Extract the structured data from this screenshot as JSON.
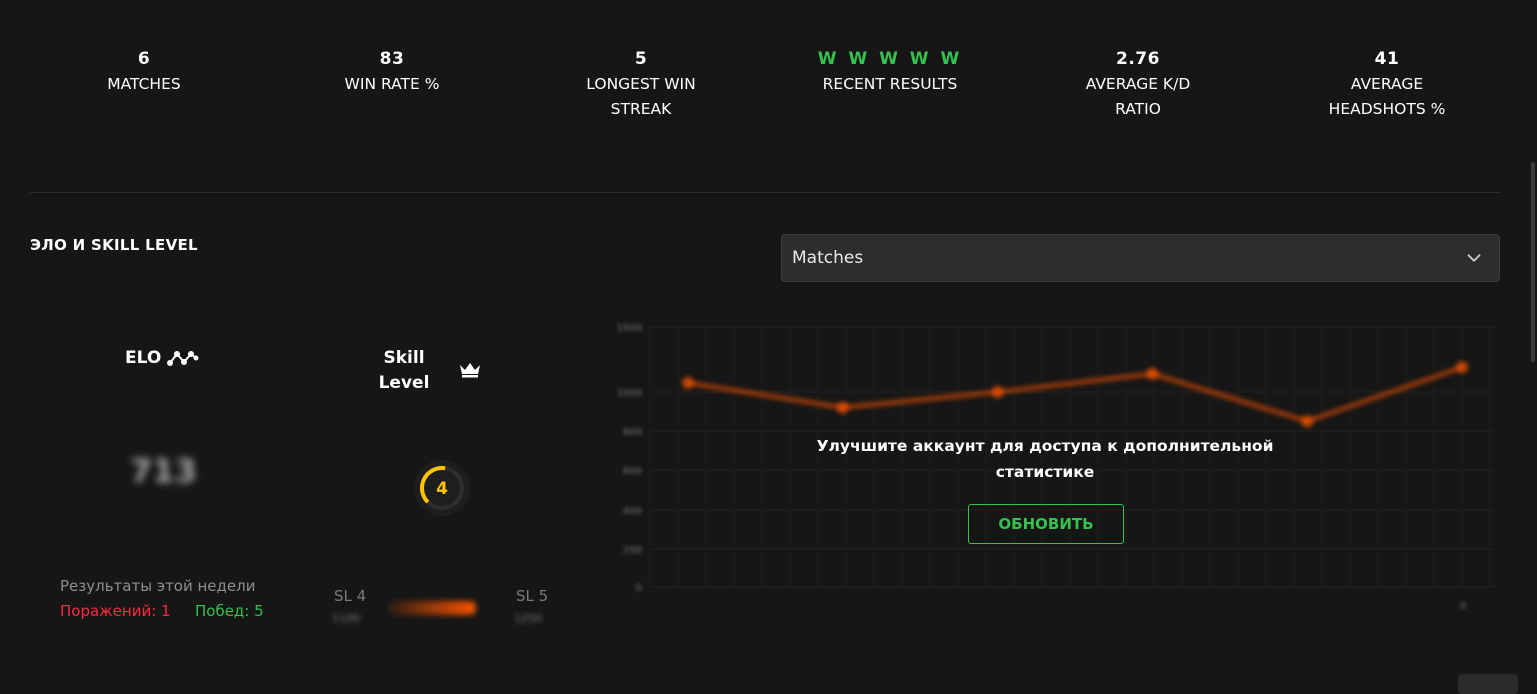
{
  "stats": [
    {
      "value": "6",
      "label": "MATCHES"
    },
    {
      "value": "83",
      "label": "WIN RATE %"
    },
    {
      "value": "5",
      "label": "LONGEST WIN\nSTREAK"
    },
    {
      "value": "W W W W W",
      "label": "RECENT RESULTS"
    },
    {
      "value": "2.76",
      "label": "AVERAGE K/D\nRATIO"
    },
    {
      "value": "41",
      "label": "AVERAGE\nHEADSHOTS %"
    }
  ],
  "section": {
    "title": "ЭЛО И SKILL LEVEL"
  },
  "dropdown": {
    "selected": "Matches"
  },
  "elo": {
    "label": "ELO",
    "value": "713"
  },
  "skill": {
    "label": "Skill\nLevel",
    "level": "4",
    "level_fraction": 0.4
  },
  "week": {
    "title": "Результаты этой недели",
    "losses_label": "Поражений: 1",
    "wins_label": "Побед: 5"
  },
  "sl_progress": {
    "left": "SL 4",
    "left_sub": "1100",
    "right": "SL 5",
    "right_sub": "1250"
  },
  "chart_data": {
    "type": "line",
    "ylim": [
      0,
      1500
    ],
    "yticks": [
      "1500",
      "1000",
      "800",
      "600",
      "400",
      "200",
      "0"
    ],
    "xticks": [
      "0"
    ],
    "series": [
      {
        "values": [
          1070,
          920,
          1000,
          1140,
          850,
          1190
        ]
      }
    ],
    "blurred": true
  },
  "upgrade": {
    "message": "Улучшите аккаунт для доступа к дополнительной статистике",
    "button": "ОБНОВИТЬ"
  },
  "colors": {
    "background": "#161616",
    "win": "#32c24d",
    "loss": "#ff2a3f",
    "accent": "#ff5500",
    "skill_ring": "#ffc400"
  }
}
